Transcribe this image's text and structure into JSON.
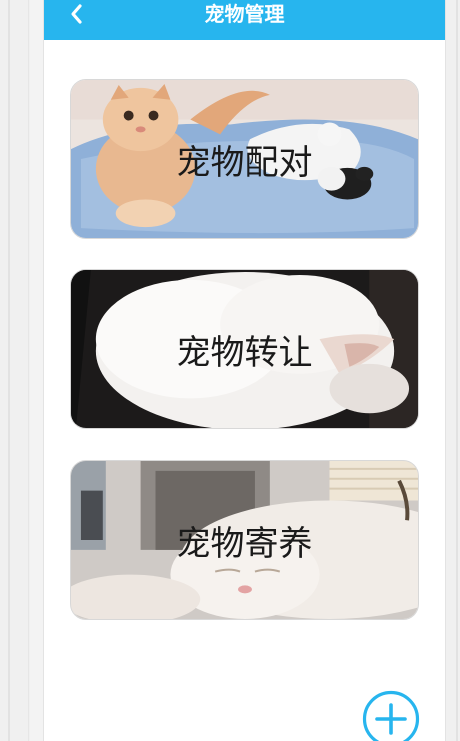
{
  "header": {
    "title": "宠物管理",
    "color": "#27b5ee"
  },
  "cards": [
    {
      "label": "宠物配对"
    },
    {
      "label": "宠物转让"
    },
    {
      "label": "宠物寄养"
    }
  ],
  "icons": {
    "back": "chevron-left-icon",
    "add": "plus-circle-icon"
  }
}
